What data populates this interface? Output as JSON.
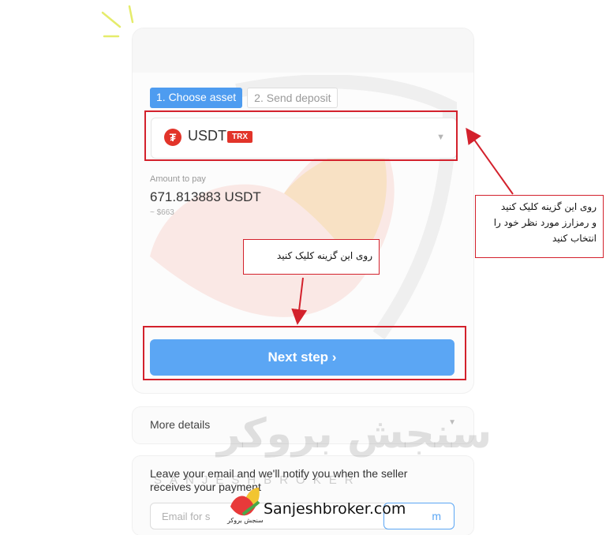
{
  "steps": {
    "step1": "1. Choose asset",
    "step2": "2. Send deposit"
  },
  "asset": {
    "symbol_icon": "tether-icon",
    "logo_char": "₮",
    "name": "USDT",
    "network": "TRX"
  },
  "amount": {
    "label": "Amount to pay",
    "value": "671.813883 USDT",
    "usd": "~ $663"
  },
  "next_button": {
    "label": "Next step ›"
  },
  "details": {
    "label": "More details"
  },
  "email": {
    "text": "Leave your email and we'll notify you when the seller receives your payment",
    "placeholder": "Email for s",
    "button": "m"
  },
  "annotations": {
    "right_note": [
      "روی این گزینه کلیک کنید",
      "و رمزارز مورد نظر خود را",
      "انتخاب کنید"
    ],
    "middle_note": "روی این گزینه کلیک کنید"
  },
  "watermark": {
    "persian": "سنجش بروکر",
    "english": "SANJESHBROKER",
    "brand_persian": "سنجش بروکر",
    "url": "Sanjeshbroker.com"
  },
  "colors": {
    "accent": "#5ba6f4",
    "annotation_red": "#d3212c",
    "tether_red": "#e2342a"
  }
}
